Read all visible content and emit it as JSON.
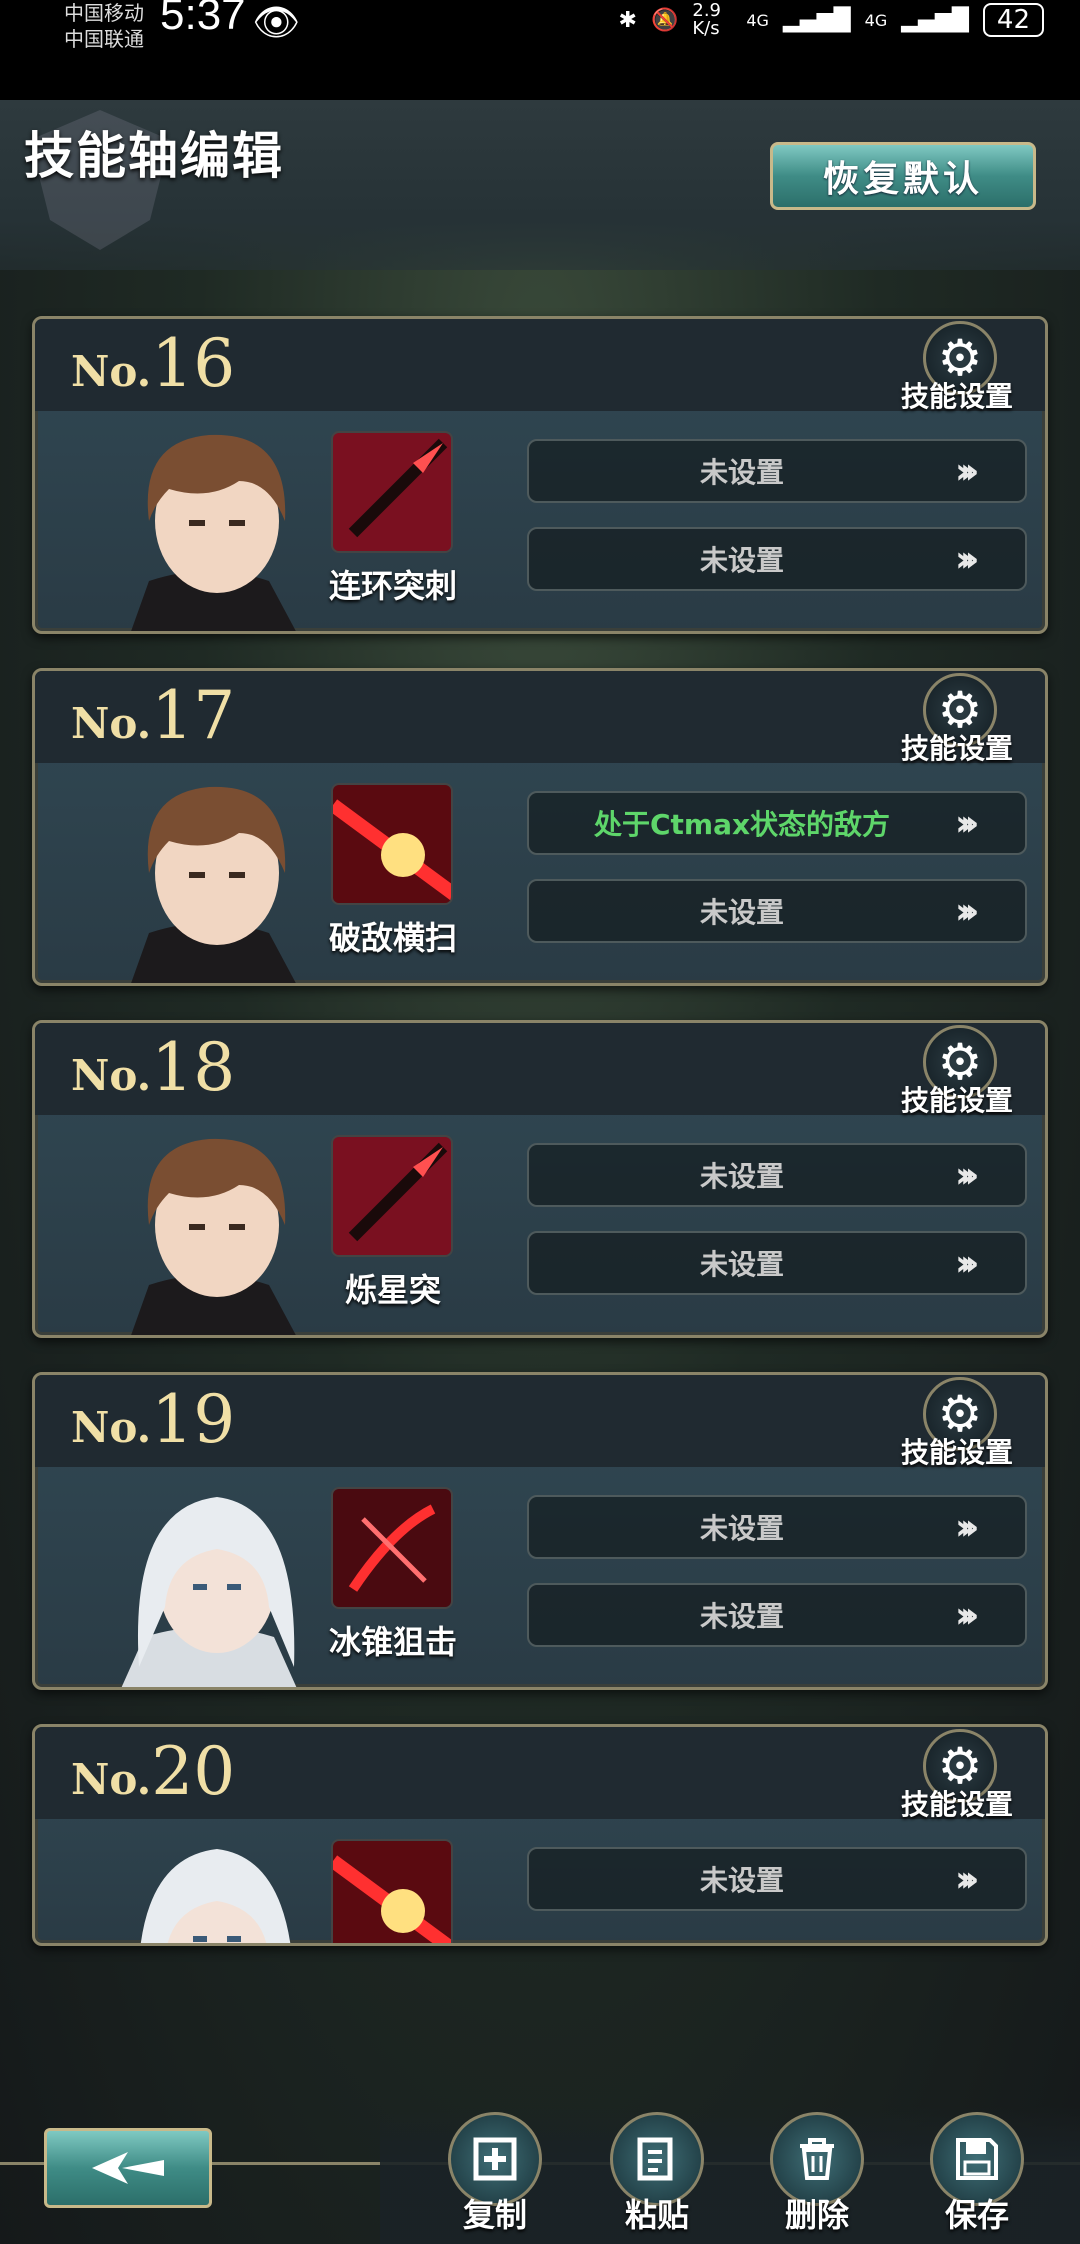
{
  "status_bar": {
    "carrier1": "中国移动",
    "carrier2": "中国联通",
    "time": "5:37",
    "net_speed": "2.9 K/s",
    "net1": "4G",
    "net2": "4G",
    "battery": "42"
  },
  "header": {
    "title": "技能轴编辑",
    "restore_label": "恢复默认"
  },
  "cards": [
    {
      "no_prefix": "No.",
      "no": "16",
      "skill_setting": "技能设置",
      "skill_name": "连环突刺",
      "char": "male",
      "icon": "spear",
      "slot1": "未设置",
      "slot2": "未设置"
    },
    {
      "no_prefix": "No.",
      "no": "17",
      "skill_setting": "技能设置",
      "skill_name": "破敌横扫",
      "char": "male",
      "icon": "slash",
      "slot1": "处于Ctmax状态的敌方",
      "slot2": "未设置"
    },
    {
      "no_prefix": "No.",
      "no": "18",
      "skill_setting": "技能设置",
      "skill_name": "烁星突",
      "char": "male",
      "icon": "spear",
      "slot1": "未设置",
      "slot2": "未设置"
    },
    {
      "no_prefix": "No.",
      "no": "19",
      "skill_setting": "技能设置",
      "skill_name": "冰锥狙击",
      "char": "female",
      "icon": "bow",
      "slot1": "未设置",
      "slot2": "未设置"
    },
    {
      "no_prefix": "No.",
      "no": "20",
      "skill_setting": "技能设置",
      "skill_name": "",
      "char": "female",
      "icon": "slash",
      "slot1": "未设置",
      "slot2": ""
    }
  ],
  "toolbar": {
    "copy": "复制",
    "paste": "粘贴",
    "delete": "删除",
    "save": "保存"
  },
  "colors": {
    "accent_teal": "#3f8c86",
    "gold_border": "#8a8468",
    "number_gold": "#f0dfa6",
    "green_text": "#5ed66a"
  }
}
